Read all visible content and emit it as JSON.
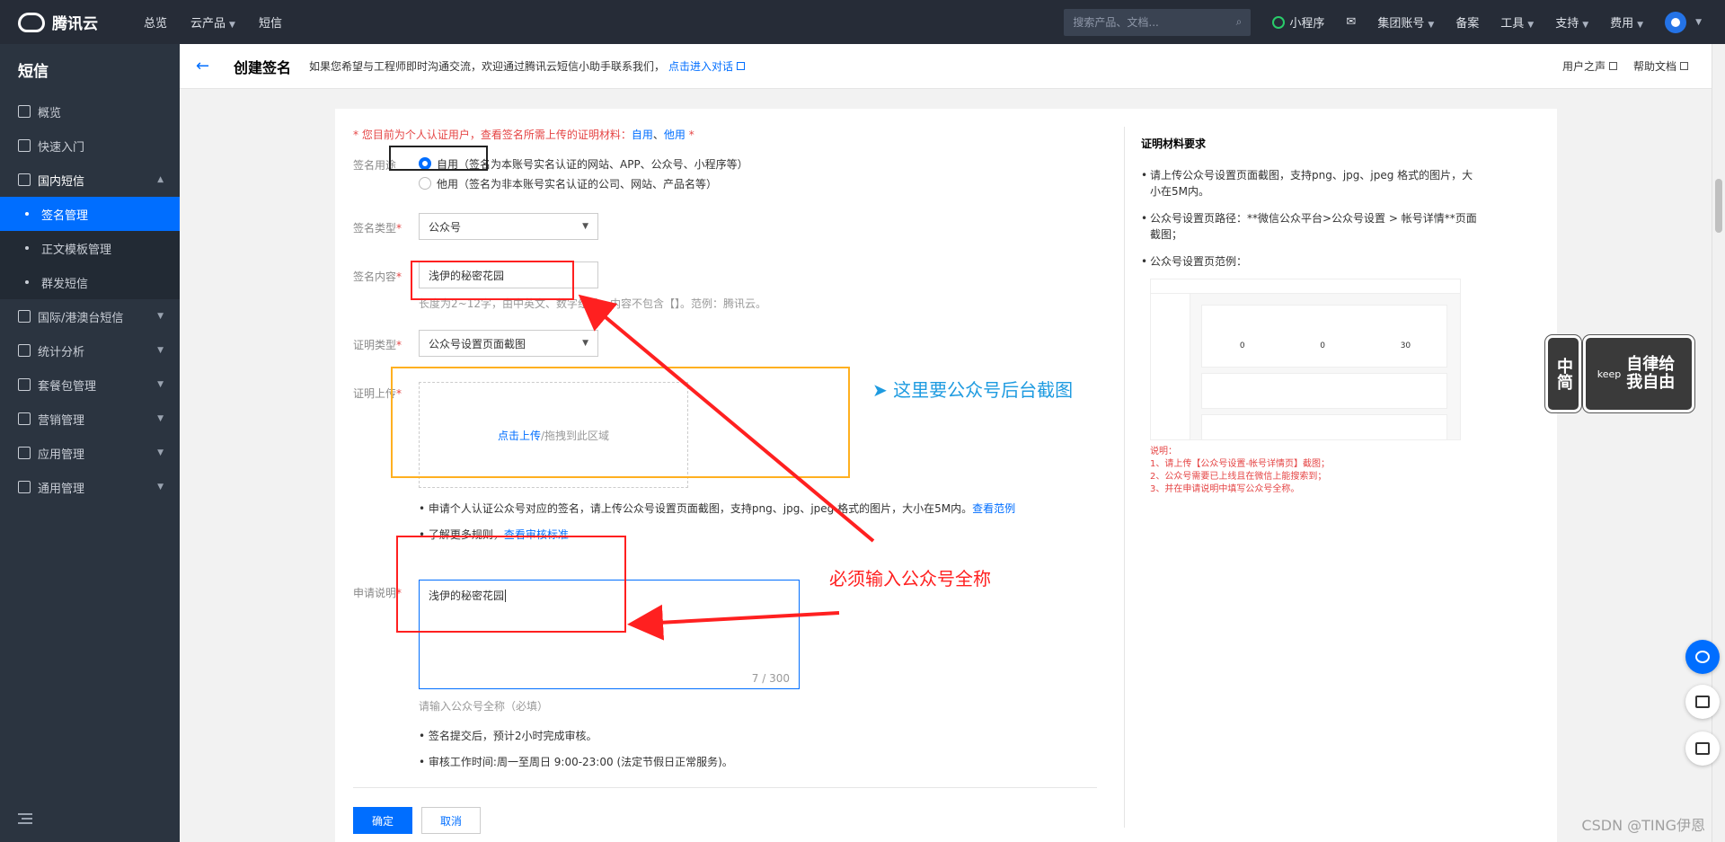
{
  "topbar": {
    "brand": "腾讯云",
    "nav": [
      "总览",
      "云产品",
      "短信"
    ],
    "search_placeholder": "搜索产品、文档...",
    "mini_program": "小程序",
    "right_items": [
      "集团账号",
      "备案",
      "工具",
      "支持",
      "费用"
    ]
  },
  "sidebar": {
    "title": "短信",
    "items": [
      {
        "label": "概览"
      },
      {
        "label": "快速入门"
      },
      {
        "label": "国内短信"
      },
      {
        "label": "签名管理"
      },
      {
        "label": "正文模板管理"
      },
      {
        "label": "群发短信"
      },
      {
        "label": "国际/港澳台短信"
      },
      {
        "label": "统计分析"
      },
      {
        "label": "套餐包管理"
      },
      {
        "label": "营销管理"
      },
      {
        "label": "应用管理"
      },
      {
        "label": "通用管理"
      }
    ]
  },
  "header": {
    "title": "创建签名",
    "tip": "如果您希望与工程师即时沟通交流，欢迎通过腾讯云短信小助手联系我们，",
    "tip_link": "点击进入对话",
    "links": [
      "用户之声",
      "帮助文档"
    ]
  },
  "form": {
    "notice_prefix": "* 您目前为个人认证用户，查看签名所需上传的证明材料：",
    "notice_link1": "自用",
    "notice_sep": "、",
    "notice_link2": "他用",
    "notice_suffix": " *",
    "usage_label": "签名用途",
    "usage_opt1": "自用（签名为本账号实名认证的网站、APP、公众号、小程序等）",
    "usage_opt2": "他用（签名为非本账号实名认证的公司、网站、产品名等）",
    "type_label": "签名类型",
    "type_value": "公众号",
    "content_label": "签名内容",
    "content_value": "浅伊的秘密花园",
    "content_hint": "长度为2~12字，由中英文、数字组成，内容不包含【】。范例：腾讯云。",
    "proof_type_label": "证明类型",
    "proof_type_value": "公众号设置页面截图",
    "upload_label": "证明上传",
    "upload_link": "点击上传",
    "upload_text": "/拖拽到此区域",
    "bullet1": "申请个人认证公众号对应的签名，请上传公众号设置页面截图，支持png、jpg、jpeg 格式的图片，大小在5M内。",
    "bullet1_link": "查看范例",
    "bullet2": "了解更多规则，",
    "bullet2_link": "查看审核标准",
    "desc_label": "申请说明",
    "desc_value": "浅伊的秘密花园",
    "desc_count": "7 / 300",
    "desc_hint": "请输入公众号全称（必填）",
    "bullet3": "签名提交后，预计2小时完成审核。",
    "bullet4": "审核工作时间:周一至周日 9:00-23:00 (法定节假日正常服务)。",
    "ok": "确定",
    "cancel": "取消"
  },
  "right_panel": {
    "title": "证明材料要求",
    "line1": "请上传公众号设置页面截图，支持png、jpg、jpeg 格式的图片，大小在5M内。",
    "line2": "公众号设置页路径：**微信公众平台>公众号设置 > 帐号详情**页面截图；",
    "line3": "公众号设置页范例：",
    "example_stats": [
      "0",
      "0",
      "30"
    ],
    "note_title": "说明：",
    "note1": "1、请上传【公众号设置-帐号详情页】截图；",
    "note2": "2、公众号需要已上线且在微信上能搜索到；",
    "note3": "3、并在申请说明中填写公众号全称。"
  },
  "annotations": {
    "upload_note": "➤ 这里要公众号后台截图",
    "fullname_note": "必须输入公众号全称"
  },
  "stickers": {
    "left": "中简",
    "right_brand": "keep",
    "right_text": "自律给我自由"
  },
  "watermark": "CSDN @TING伊恩",
  "colors": {
    "accent": "#006eff",
    "annotation_red": "#ff2020",
    "annotation_orange": "#ffb020",
    "annotation_blue": "#1e9be0"
  }
}
